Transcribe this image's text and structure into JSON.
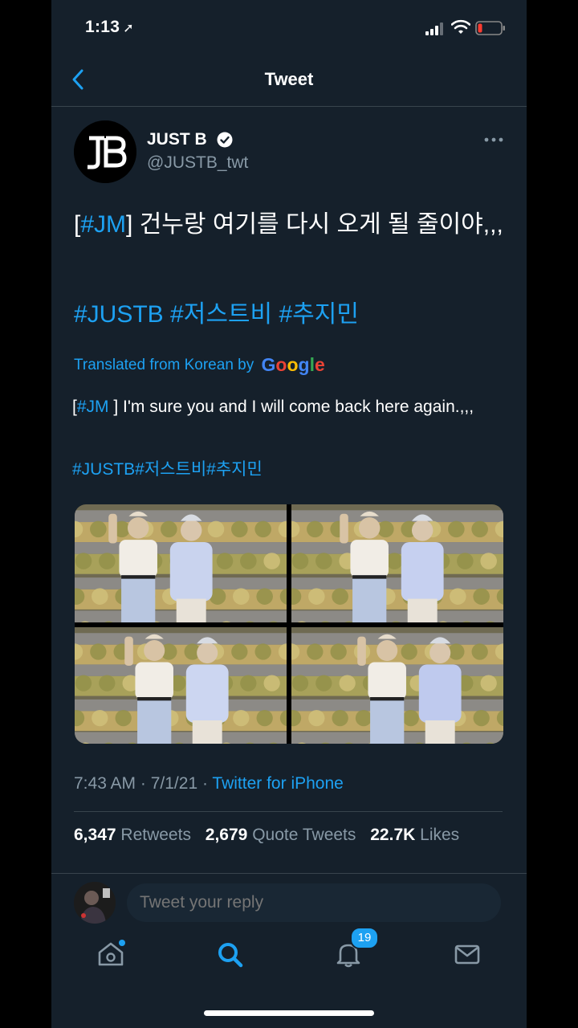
{
  "status_bar": {
    "time": "1:13",
    "location_icon": "location-arrow-icon"
  },
  "nav": {
    "title": "Tweet",
    "back_icon": "chevron-left-icon"
  },
  "author": {
    "name": "JUST B",
    "handle": "@JUSTB_twt",
    "avatar_text": "JB",
    "verified": true
  },
  "tweet": {
    "tag_open": "[",
    "tag": "#JM",
    "tag_close": "]",
    "text": " 건누랑 여기를 다시 오게 될 줄이야,,,",
    "hashtags": "#JUSTB #저스트비 #추지민"
  },
  "translation": {
    "label": "Translated from Korean by",
    "google": [
      "G",
      "o",
      "o",
      "g",
      "l",
      "e"
    ],
    "google_colors": [
      "#4285f4",
      "#ea4335",
      "#fbbc05",
      "#4285f4",
      "#34a853",
      "#ea4335"
    ],
    "tag_open": "[",
    "tag": "#JM",
    "tag_close": " ]",
    "text": " I'm sure you and I will come back here again.,,,",
    "hashtags": "#JUSTB#저스트비#추지민"
  },
  "meta": {
    "time": "7:43 AM",
    "sep1": " · ",
    "date": "7/1/21",
    "sep2": " · ",
    "source": "Twitter for iPhone"
  },
  "stats": {
    "retweets_count": "6,347",
    "retweets_label": "Retweets",
    "quotes_count": "2,679",
    "quotes_label": "Quote Tweets",
    "likes_count": "22.7K",
    "likes_label": "Likes"
  },
  "reply": {
    "placeholder": "Tweet your reply"
  },
  "tabbar": {
    "notifications_badge": "19"
  },
  "colors": {
    "background": "#15202b",
    "accent": "#1da1f2",
    "secondary_text": "#8899a6",
    "divider": "#38444d"
  }
}
